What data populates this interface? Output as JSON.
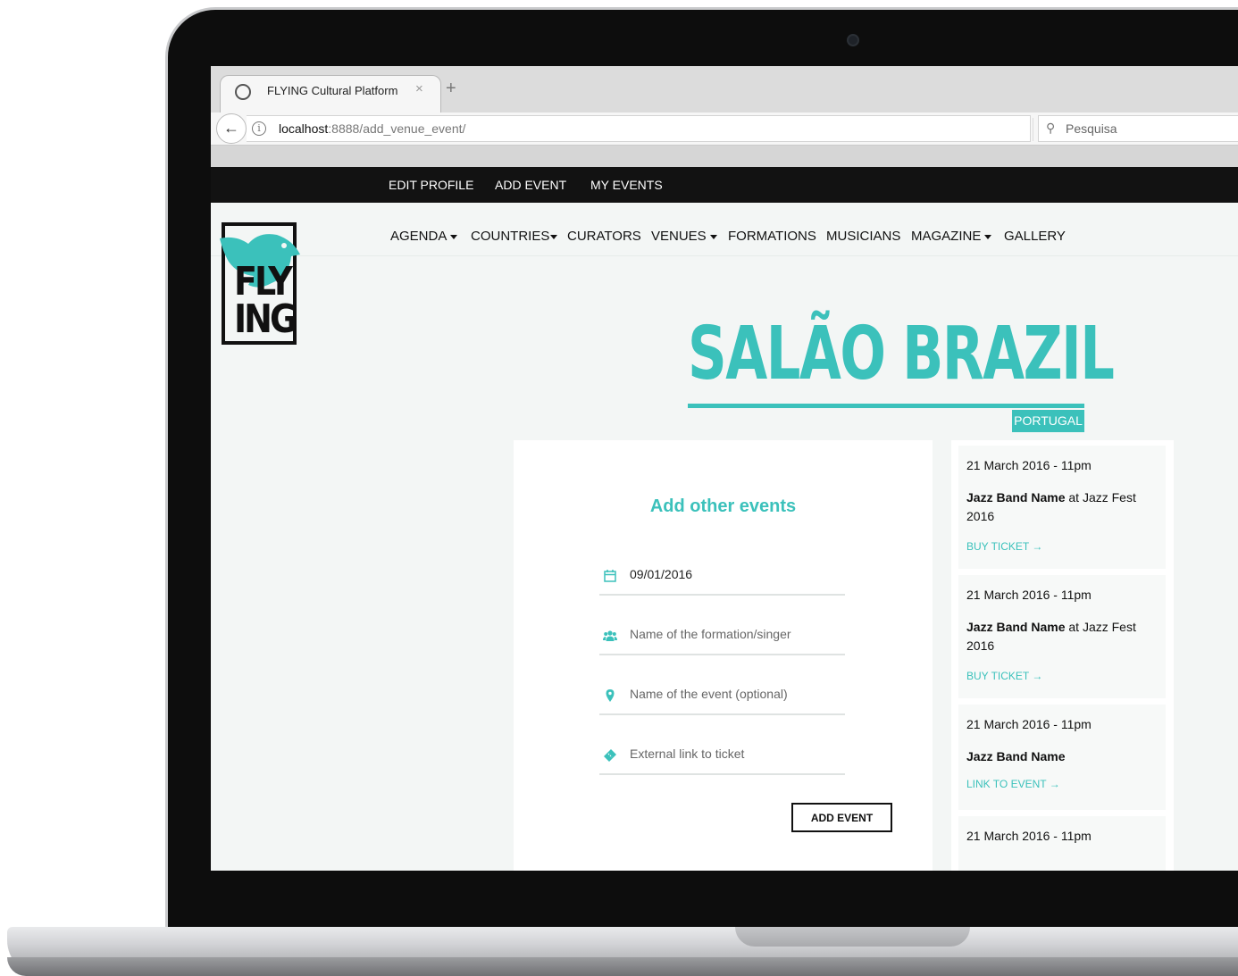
{
  "browser": {
    "tab_title": "FLYING Cultural Platform",
    "tab_close": "×",
    "tab_new": "+",
    "url_host": "localhost",
    "url_path": ":8888/add_venue_event/",
    "search_placeholder": "Pesquisa"
  },
  "topnav": {
    "edit_profile": "EDIT PROFILE",
    "add_event": "ADD EVENT",
    "my_events": "MY EVENTS"
  },
  "logo": {
    "line1": "FLY",
    "line2": "ING"
  },
  "mainnav": {
    "agenda": "AGENDA",
    "countries": "COUNTRIES",
    "curators": "CURATORS",
    "venues": "VENUES",
    "formations": "FORMATIONS",
    "musicians": "MUSICIANS",
    "magazine": "MAGAZINE",
    "gallery": "GALLERY"
  },
  "venue": {
    "name": "SALÃO BRAZIL",
    "country": "PORTUGAL"
  },
  "form": {
    "heading": "Add other events",
    "date_value": "09/01/2016",
    "formation_placeholder": "Name of the formation/singer",
    "event_name_placeholder": "Name of the event (optional)",
    "ticket_link_placeholder": "External link to ticket",
    "submit_label": "ADD EVENT"
  },
  "events": [
    {
      "date": "21 March 2016 - 11pm",
      "band": "Jazz Band Name",
      "connector": " at ",
      "festival": "Jazz Fest 2016",
      "link": "BUY TICKET →"
    },
    {
      "date": "21 March 2016 - 11pm",
      "band": "Jazz Band Name",
      "connector": " at ",
      "festival": "Jazz Fest 2016",
      "link": "BUY TICKET →"
    },
    {
      "date": "21 March 2016 - 11pm",
      "band": "Jazz Band Name",
      "connector": "",
      "festival": "",
      "link": "LINK TO EVENT →"
    },
    {
      "date": "21 March 2016 - 11pm"
    }
  ],
  "colors": {
    "accent": "#3bc1bb",
    "topnav_bg": "#121212",
    "page_bg": "#f3f6f5"
  },
  "icons": {
    "date_field": "calendar-icon",
    "formation_field": "users-icon",
    "event_field": "map-pin-icon",
    "ticket_field": "ticket-icon"
  }
}
